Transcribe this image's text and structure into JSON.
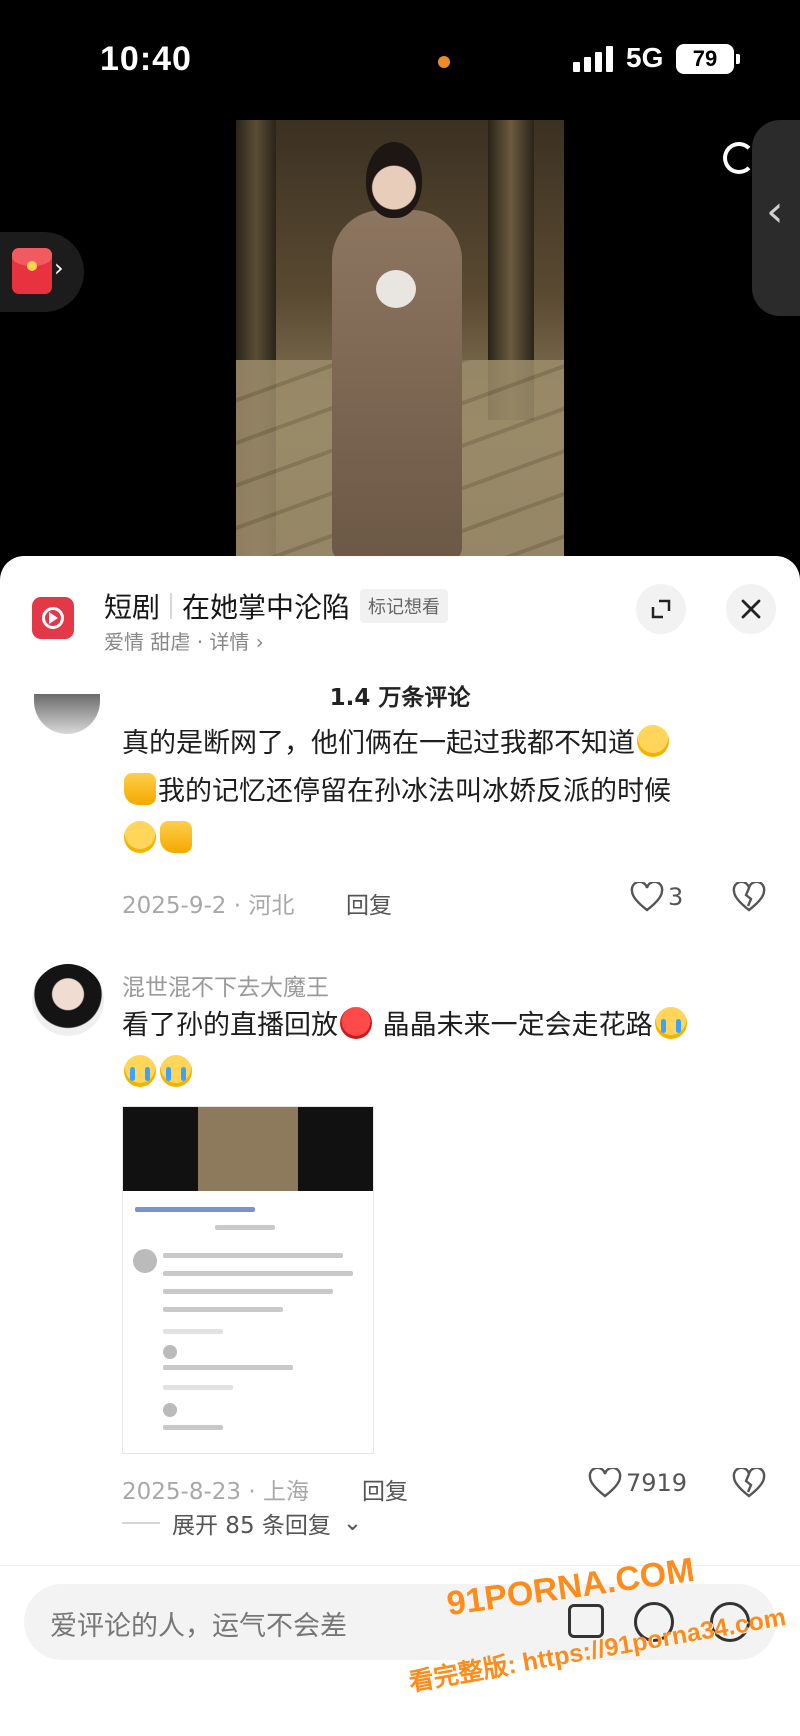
{
  "status": {
    "time": "10:40",
    "network": "5G",
    "battery": "79"
  },
  "drama": {
    "label": "短剧",
    "title": "在她掌中沦陷",
    "mark_tag": "标记想看",
    "subtitle": "爱情 甜虐 · 详情 ›"
  },
  "comments_count": "1.4 万条评论",
  "comments": [
    {
      "text_part1": "真的是断网了，他们俩在一起过我都不知道",
      "text_part2": "我的记忆还停留在孙冰法叫冰娇反派的时候",
      "date_location": "2025-9-2 · 河北",
      "reply_label": "回复",
      "likes": "3"
    },
    {
      "username": "混世混不下去大魔王",
      "text_part1": "看了孙的直播回放",
      "text_part2": "晶晶未来一定会走花路",
      "date_location": "2025-8-23 · 上海",
      "reply_label": "回复",
      "likes": "7919",
      "expand_replies": "展开 85 条回复"
    }
  ],
  "input": {
    "placeholder": "爱评论的人，运气不会差"
  },
  "watermark": {
    "logo": "91PORNA.COM",
    "url": "看完整版: https://91porna34.com"
  },
  "icons": {
    "expand": "expand-icon",
    "close": "close-icon",
    "heart": "heart-icon",
    "dislike": "broken-heart-icon",
    "at": "at-icon",
    "emoji": "smile-icon",
    "image": "image-icon",
    "red_packet": "red-packet-icon",
    "drama": "short-drama-icon"
  }
}
